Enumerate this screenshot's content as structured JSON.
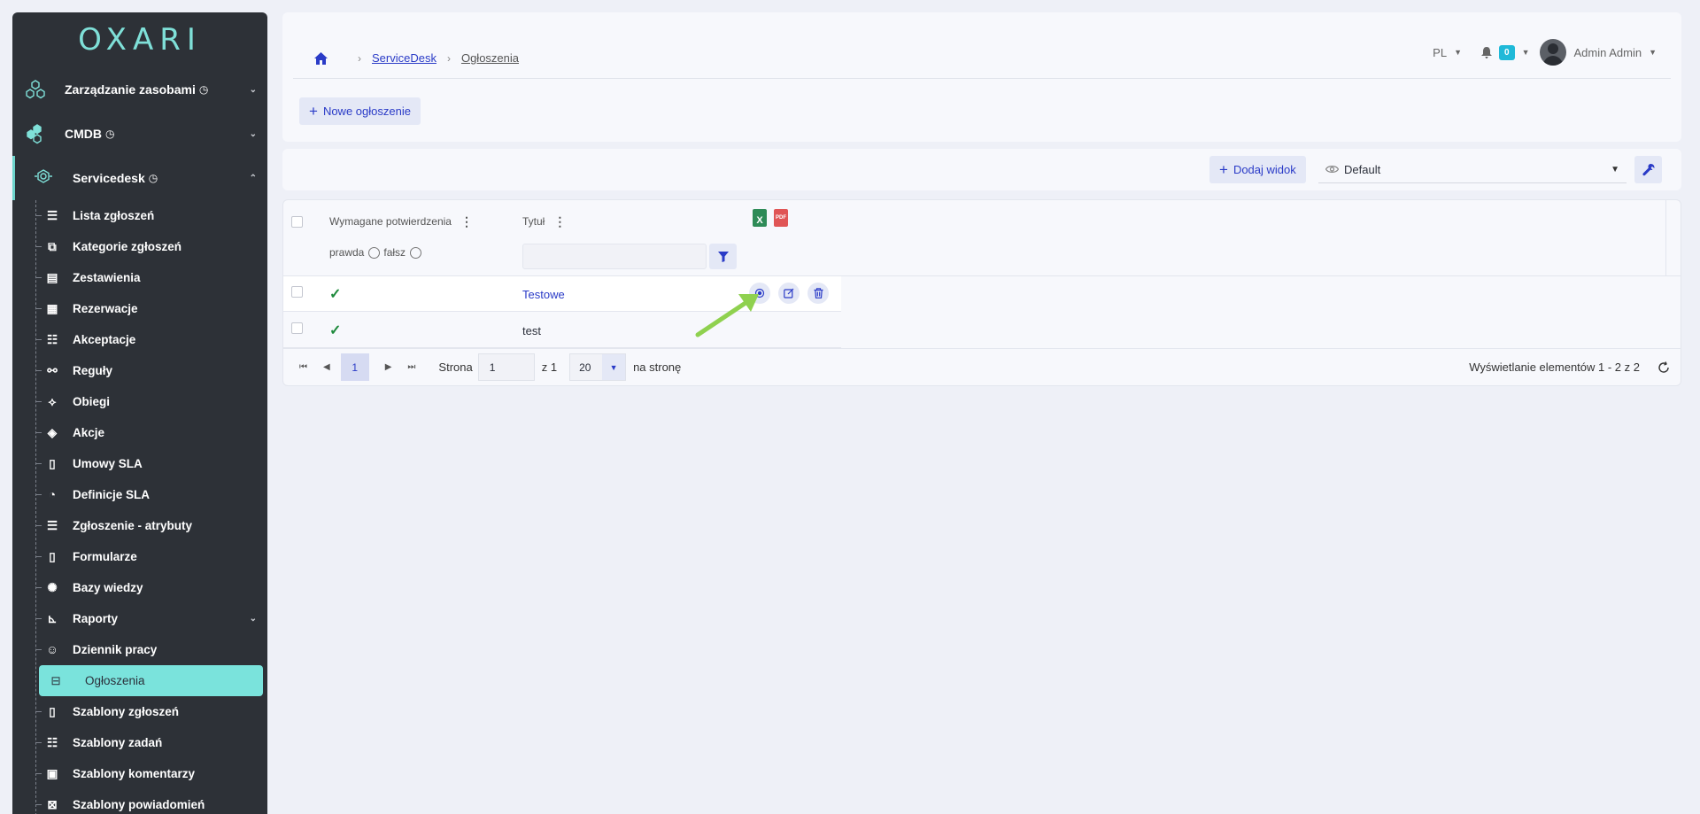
{
  "logo": "OXARI",
  "sidebar": {
    "main": [
      {
        "label": "Zarządzanie zasobami",
        "icon": "hexagon-cluster-icon"
      },
      {
        "label": "CMDB",
        "icon": "hexagon-cubes-icon"
      },
      {
        "label": "Servicedesk",
        "icon": "servicedesk-icon"
      }
    ],
    "sub": [
      {
        "label": "Lista zgłoszeń",
        "icon": "list-icon"
      },
      {
        "label": "Kategorie zgłoszeń",
        "icon": "categories-icon"
      },
      {
        "label": "Zestawienia",
        "icon": "table-icon"
      },
      {
        "label": "Rezerwacje",
        "icon": "calendar-icon"
      },
      {
        "label": "Akceptacje",
        "icon": "checklist-icon"
      },
      {
        "label": "Reguły",
        "icon": "rules-icon"
      },
      {
        "label": "Obiegi",
        "icon": "workflow-icon"
      },
      {
        "label": "Akcje",
        "icon": "actions-icon"
      },
      {
        "label": "Umowy SLA",
        "icon": "document-icon"
      },
      {
        "label": "Definicje SLA",
        "icon": "stopwatch-icon"
      },
      {
        "label": "Zgłoszenie - atrybuty",
        "icon": "list-icon"
      },
      {
        "label": "Formularze",
        "icon": "form-icon"
      },
      {
        "label": "Bazy wiedzy",
        "icon": "lightbulb-icon"
      },
      {
        "label": "Raporty",
        "icon": "chart-icon"
      },
      {
        "label": "Dziennik pracy",
        "icon": "user-clock-icon"
      },
      {
        "label": "Ogłoszenia",
        "icon": "announcement-icon"
      },
      {
        "label": "Szablony zgłoszeń",
        "icon": "document-icon"
      },
      {
        "label": "Szablony zadań",
        "icon": "checklist-icon"
      },
      {
        "label": "Szablony komentarzy",
        "icon": "comment-template-icon"
      },
      {
        "label": "Szablony powiadomień",
        "icon": "notification-template-icon"
      }
    ]
  },
  "breadcrumb": {
    "home": "home-icon",
    "items": [
      "ServiceDesk",
      "Ogłoszenia"
    ]
  },
  "header": {
    "lang": "PL",
    "notifications": "0",
    "user": "Admin Admin"
  },
  "actions": {
    "new_label": "Nowe ogłoszenie"
  },
  "toolbar": {
    "add_view": "Dodaj widok",
    "view": "Default"
  },
  "grid": {
    "columns": [
      "Wymagane potwierdzenia",
      "Tytuł"
    ],
    "filter": {
      "true_label": "prawda",
      "false_label": "fałsz",
      "text": ""
    },
    "rows": [
      {
        "confirmed": true,
        "title": "Testowe"
      },
      {
        "confirmed": true,
        "title": "test"
      }
    ]
  },
  "pager": {
    "current": "1",
    "page_label": "Strona",
    "page_value": "1",
    "of": "z 1",
    "size": "20",
    "per_page": "na stronę",
    "info": "Wyświetlanie elementów 1 - 2 z 2"
  },
  "colors": {
    "accent": "#2a3bc7",
    "teal": "#7ae3dc",
    "sidebar": "#2d3137",
    "arrow": "#8fd14f"
  }
}
